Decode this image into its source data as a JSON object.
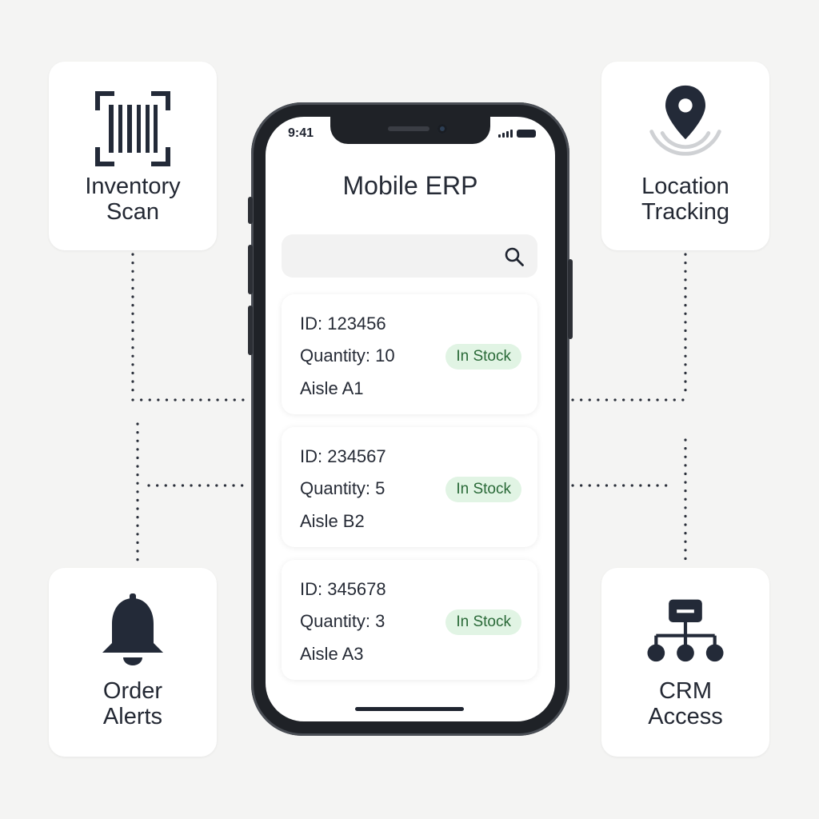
{
  "features": {
    "scan": {
      "label": "Inventory\nScan",
      "icon": "barcode-scan-icon"
    },
    "location": {
      "label": "Location\nTracking",
      "icon": "location-pin-icon"
    },
    "alerts": {
      "label": "Order\nAlerts",
      "icon": "bell-icon"
    },
    "crm": {
      "label": "CRM\nAccess",
      "icon": "org-hierarchy-icon"
    }
  },
  "phone": {
    "status_time": "9:41",
    "app_title": "Mobile ERP",
    "search": {
      "placeholder": "",
      "value": "",
      "icon": "search-icon"
    },
    "items": [
      {
        "id": "ID: 123456",
        "quantity": "Quantity: 10",
        "aisle": "Aisle A1",
        "status": "In Stock"
      },
      {
        "id": "ID: 234567",
        "quantity": "Quantity: 5",
        "aisle": "Aisle B2",
        "status": "In Stock"
      },
      {
        "id": "ID: 345678",
        "quantity": "Quantity: 3",
        "aisle": "Aisle A3",
        "status": "In Stock"
      }
    ]
  },
  "colors": {
    "background": "#f4f4f3",
    "icon_dark": "#232a38",
    "badge_bg": "#e1f4e4",
    "badge_text": "#2a6a38",
    "phone_frame": "#1f2227"
  }
}
